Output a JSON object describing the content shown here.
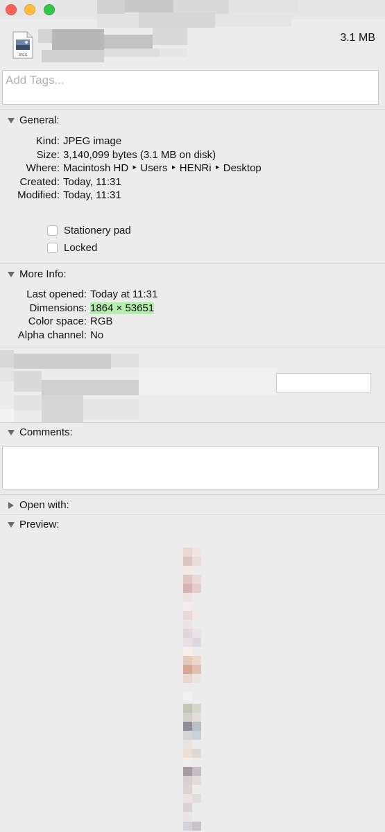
{
  "file": {
    "size_label": "3.1 MB",
    "icon_label": "JPEG"
  },
  "tags": {
    "placeholder": "Add Tags..."
  },
  "general": {
    "header": "General:",
    "rows": [
      {
        "key": "Kind:",
        "value": "JPEG image"
      },
      {
        "key": "Size:",
        "value": "3,140,099 bytes (3.1 MB on disk)"
      },
      {
        "key": "Where:",
        "value": "Macintosh HD ‣ Users ‣ HENRi ‣ Desktop"
      },
      {
        "key": "Created:",
        "value": "Today, 11:31"
      },
      {
        "key": "Modified:",
        "value": "Today, 11:31"
      }
    ],
    "stationery_label": "Stationery pad",
    "locked_label": "Locked"
  },
  "more_info": {
    "header": "More Info:",
    "rows": [
      {
        "key": "Last opened:",
        "value": "Today at 11:31"
      },
      {
        "key": "Dimensions:",
        "value": "1864 × 53651"
      },
      {
        "key": "Color space:",
        "value": "RGB"
      },
      {
        "key": "Alpha channel:",
        "value": "No"
      }
    ]
  },
  "comments": {
    "header": "Comments:"
  },
  "open_with": {
    "header": "Open with:"
  },
  "preview": {
    "header": "Preview:"
  },
  "colors": {
    "window_bg": "#ececec",
    "dimension_highlight": "#b6eeb0",
    "traffic_red": "#fc605c",
    "traffic_yellow": "#fdbc40",
    "traffic_green": "#34c84a"
  }
}
